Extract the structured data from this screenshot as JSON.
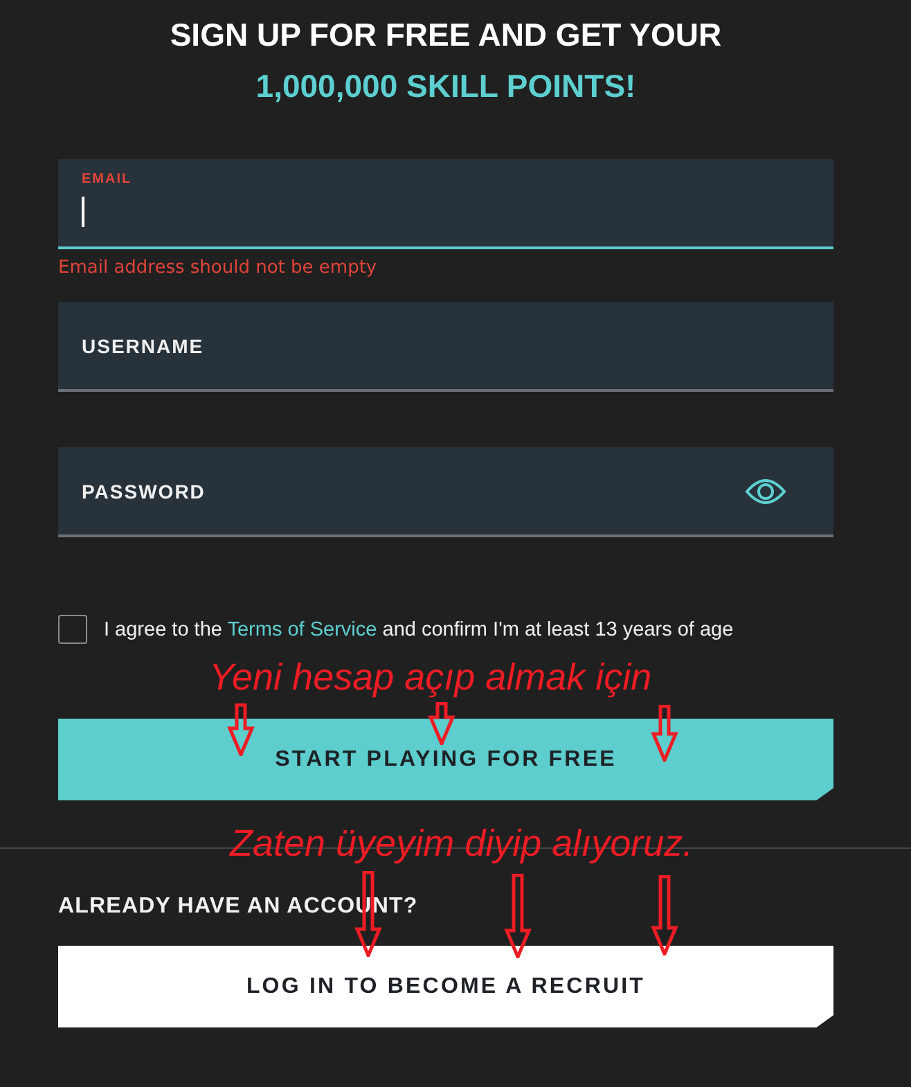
{
  "heading": {
    "line_1": "SIGN UP FOR FREE AND GET YOUR",
    "line_2": "1,000,000 SKILL POINTS!"
  },
  "fields": [
    {
      "kind": "email",
      "label": "EMAIL",
      "focused": true,
      "error": "Email address should not be empty"
    },
    {
      "kind": "username",
      "label": "USERNAME",
      "focused": false
    },
    {
      "kind": "password",
      "label": "PASSWORD",
      "focused": false
    }
  ],
  "agreement": {
    "checked": false,
    "before": "I agree to the",
    "link": "Terms of Service",
    "after": "and confirm I'm at least 13 years of age"
  },
  "primary_button": "START PLAYING FOR FREE",
  "login": {
    "prompt": "ALREADY HAVE AN ACCOUNT?",
    "button": "LOG IN TO BECOME A RECRUIT"
  },
  "annotations": [
    {
      "text": "Yeni hesap açıp almak için"
    },
    {
      "text": "Zaten üyeyim diyip alıyoruz."
    }
  ]
}
